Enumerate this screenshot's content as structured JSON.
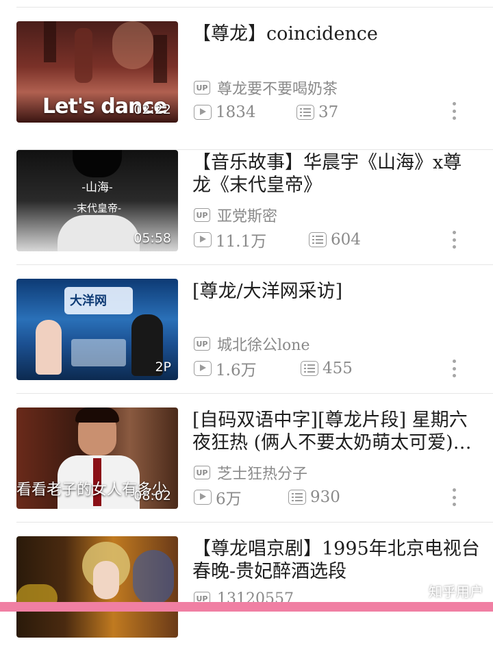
{
  "videos": [
    {
      "title": "【尊龙】coincidence",
      "uploader": "尊龙要不要喝奶茶",
      "plays": "1834",
      "danmaku": "37",
      "duration": "02:22",
      "overlay_text": "Let's  dance"
    },
    {
      "title": "【音乐故事】华晨宇《山海》x尊龙《末代皇帝》",
      "uploader": "亚党斯密",
      "plays": "11.1万",
      "danmaku": "604",
      "duration": "05:58",
      "overlay_title_1": "-山海-",
      "overlay_title_2": "-末代皇帝-"
    },
    {
      "title": "[尊龙/大洋网采访]",
      "uploader": "城北徐公lone",
      "plays": "1.6万",
      "danmaku": "455",
      "duration": "2P",
      "overlay_logo": "大洋网"
    },
    {
      "title": "[自码双语中字][尊龙片段] 星期六夜狂热 (俩人不要太奶萌太可爱)…",
      "uploader": "芝士狂热分子",
      "plays": "6万",
      "danmaku": "930",
      "duration": "08:02",
      "overlay_text": "看看老子的女人有多少"
    },
    {
      "title": "【尊龙唱京剧】1995年北京电视台春晚-贵妃醉酒选段",
      "uploader": "13120557"
    }
  ],
  "labels": {
    "up_badge": "UP"
  },
  "watermark": "知乎用户",
  "colors": {
    "accent_bar": "#f07fa3",
    "meta_gray": "#8a8a8a"
  }
}
